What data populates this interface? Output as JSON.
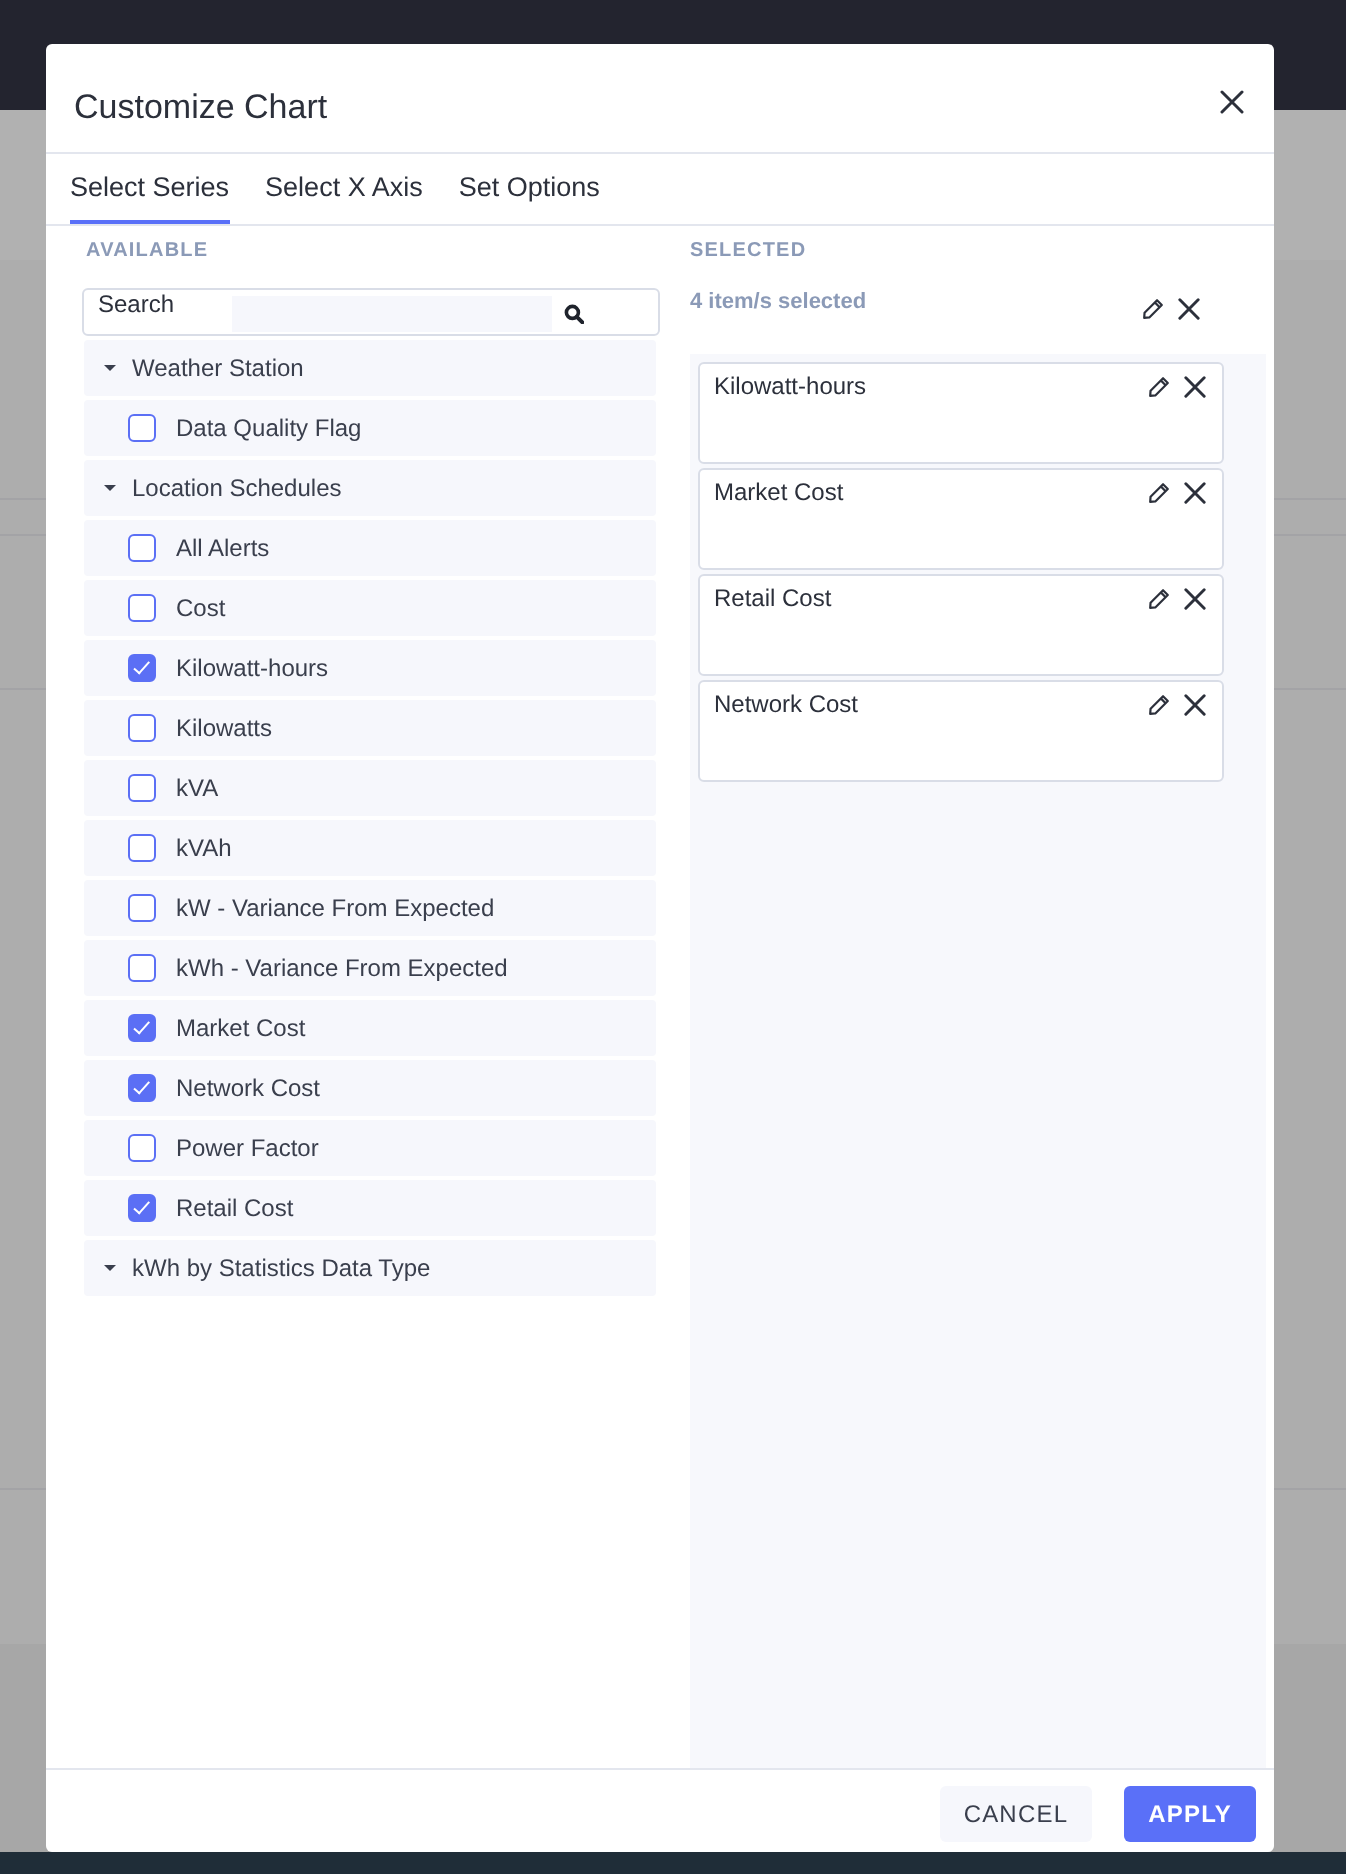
{
  "dialog": {
    "title": "Customize Chart"
  },
  "tabs": [
    {
      "label": "Select Series",
      "selected": true
    },
    {
      "label": "Select X Axis",
      "selected": false
    },
    {
      "label": "Set Options",
      "selected": false
    }
  ],
  "available": {
    "heading": "AVAILABLE",
    "search": {
      "label": "Search"
    },
    "groups": [
      {
        "label": "Weather Station",
        "expanded": true,
        "children": [
          {
            "label": "Data Quality Flag",
            "checked": false
          }
        ]
      },
      {
        "label": "Location Schedules",
        "expanded": true,
        "children": [
          {
            "label": "All Alerts",
            "checked": false
          },
          {
            "label": "Cost",
            "checked": false
          },
          {
            "label": "Kilowatt-hours",
            "checked": true
          },
          {
            "label": "Kilowatts",
            "checked": false
          },
          {
            "label": "kVA",
            "checked": false
          },
          {
            "label": "kVAh",
            "checked": false
          },
          {
            "label": "kW - Variance From Expected",
            "checked": false
          },
          {
            "label": "kWh - Variance From Expected",
            "checked": false
          },
          {
            "label": "Market Cost",
            "checked": true
          },
          {
            "label": "Network Cost",
            "checked": true
          },
          {
            "label": "Power Factor",
            "checked": false
          },
          {
            "label": "Retail Cost",
            "checked": true
          }
        ]
      },
      {
        "label": "kWh by Statistics Data Type",
        "expanded": true
      }
    ]
  },
  "selected": {
    "heading": "SELECTED",
    "count": "4 item/s selected",
    "items": [
      {
        "label": "Kilowatt-hours"
      },
      {
        "label": "Market Cost"
      },
      {
        "label": "Retail Cost"
      },
      {
        "label": "Network Cost"
      }
    ]
  },
  "buttons": [
    {
      "label": "CANCEL",
      "kind": "secondary"
    },
    {
      "label": "APPLY",
      "kind": "primary"
    }
  ]
}
